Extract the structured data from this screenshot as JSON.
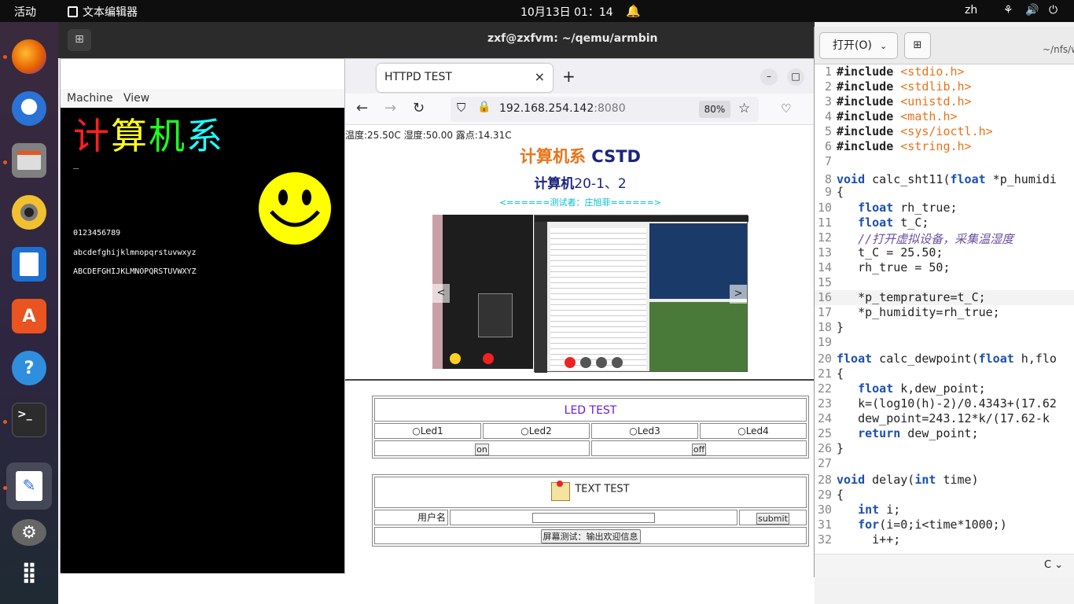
{
  "topbar": {
    "activities": "活动",
    "app_name": "文本编辑器",
    "clock": "10月13日  01：14",
    "input_method": "zh"
  },
  "terminal": {
    "title": "zxf@zxfvm: ~/qemu/armbin"
  },
  "qemu": {
    "menu": [
      "Machine",
      "View"
    ],
    "heading_chars": [
      "计",
      "算",
      "机",
      "系"
    ],
    "cursor": "_",
    "digits": "0123456789",
    "lower": "abcdefghijklmnopqrstuvwxyz",
    "upper": "ABCDEFGHIJKLMNOPQRSTUVWXYZ"
  },
  "browser": {
    "tab_title": "HTTPD TEST",
    "url_host": "192.168.254.142",
    "url_port": ":8080",
    "zoom": "80%",
    "sensor": "温度:25.50C 湿度:50.00 露点:14.31C",
    "title_cn": "计算机系",
    "title_en": " CSTD",
    "subtitle_cn": "计算机",
    "subtitle_num": "20-1、2",
    "tester": "<======测试者：庄旭菲======>",
    "led_title": "LED TEST",
    "leds": [
      "Led1",
      "Led2",
      "Led3",
      "Led4"
    ],
    "on_label": "on",
    "off_label": "off",
    "text_title": "TEXT TEST",
    "user_label": "用户名",
    "submit_label": "submit",
    "screen_button": "屏幕测试：输出欢迎信息"
  },
  "editor": {
    "open_label": "打开(O)",
    "path": "~/nfs/w",
    "lang": "C",
    "lines": [
      {
        "n": "1",
        "t": "#include <stdio.h>"
      },
      {
        "n": "2",
        "t": "#include <stdlib.h>"
      },
      {
        "n": "3",
        "t": "#include <unistd.h>"
      },
      {
        "n": "4",
        "t": "#include <math.h>"
      },
      {
        "n": "5",
        "t": "#include <sys/ioctl.h>"
      },
      {
        "n": "6",
        "t": "#include <string.h>"
      },
      {
        "n": "7",
        "t": ""
      },
      {
        "n": "8",
        "t": "void calc_sht11(float *p_humidi"
      },
      {
        "n": "9",
        "t": "{"
      },
      {
        "n": "10",
        "t": "   float rh_true;"
      },
      {
        "n": "11",
        "t": "   float t_C;"
      },
      {
        "n": "12",
        "t": "   //打开虚拟设备，采集温湿度"
      },
      {
        "n": "13",
        "t": "   t_C = 25.50;"
      },
      {
        "n": "14",
        "t": "   rh_true = 50;"
      },
      {
        "n": "15",
        "t": ""
      },
      {
        "n": "16",
        "t": "   *p_temprature=t_C;"
      },
      {
        "n": "17",
        "t": "   *p_humidity=rh_true;"
      },
      {
        "n": "18",
        "t": "}"
      },
      {
        "n": "19",
        "t": ""
      },
      {
        "n": "20",
        "t": "float calc_dewpoint(float h,flo"
      },
      {
        "n": "21",
        "t": "{"
      },
      {
        "n": "22",
        "t": "   float k,dew_point;"
      },
      {
        "n": "23",
        "t": "   k=(log10(h)-2)/0.4343+(17.62"
      },
      {
        "n": "24",
        "t": "   dew_point=243.12*k/(17.62-k"
      },
      {
        "n": "25",
        "t": "   return dew_point;"
      },
      {
        "n": "26",
        "t": "}"
      },
      {
        "n": "27",
        "t": ""
      },
      {
        "n": "28",
        "t": "void delay(int time)"
      },
      {
        "n": "29",
        "t": "{"
      },
      {
        "n": "30",
        "t": "   int i;"
      },
      {
        "n": "31",
        "t": "   for(i=0;i<time*1000;)"
      },
      {
        "n": "32",
        "t": "     i++;"
      }
    ]
  },
  "colors": {
    "accent": "#e95420",
    "title_orange": "#e8731a",
    "title_navy": "#1a237e",
    "tester_cyan": "#00bcd4",
    "led_purple": "#6a1bd6"
  },
  "icons": [
    "firefox-icon",
    "thunderbird-icon",
    "files-icon",
    "rhythmbox-icon",
    "writer-icon",
    "app-center-icon",
    "help-icon",
    "terminal-icon",
    "text-editor-icon",
    "settings-icon",
    "app-grid-icon"
  ]
}
